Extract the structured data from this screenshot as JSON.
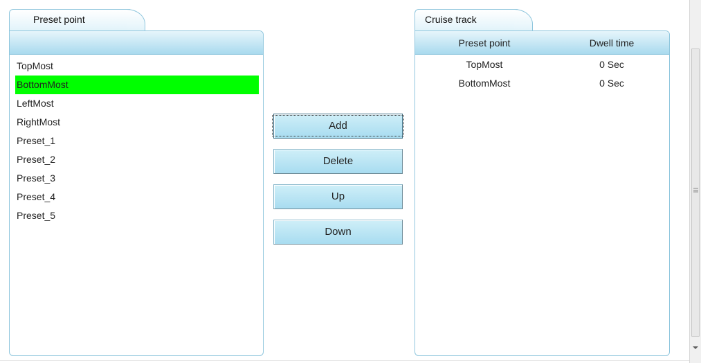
{
  "left_panel": {
    "tab_label": "Preset point",
    "items": [
      {
        "label": "TopMost",
        "selected": false
      },
      {
        "label": "BottomMost",
        "selected": true
      },
      {
        "label": "LeftMost",
        "selected": false
      },
      {
        "label": "RightMost",
        "selected": false
      },
      {
        "label": "Preset_1",
        "selected": false
      },
      {
        "label": "Preset_2",
        "selected": false
      },
      {
        "label": "Preset_3",
        "selected": false
      },
      {
        "label": "Preset_4",
        "selected": false
      },
      {
        "label": "Preset_5",
        "selected": false
      }
    ]
  },
  "buttons": {
    "add": "Add",
    "delete": "Delete",
    "up": "Up",
    "down": "Down"
  },
  "right_panel": {
    "tab_label": "Cruise track",
    "columns": [
      "Preset point",
      "Dwell time"
    ],
    "rows": [
      {
        "preset": "TopMost",
        "dwell": "0 Sec"
      },
      {
        "preset": "BottomMost",
        "dwell": "0 Sec"
      }
    ]
  },
  "colors": {
    "selected_row": "#00ff00",
    "header_gradient_top": "#e6f5fb",
    "header_gradient_bottom": "#a9daee",
    "border": "#8fc6dd",
    "button_fill": "#b8e4f3"
  },
  "icons": {
    "scroll_down": "chevron-down-icon",
    "scroll_grip": "grip-icon"
  }
}
